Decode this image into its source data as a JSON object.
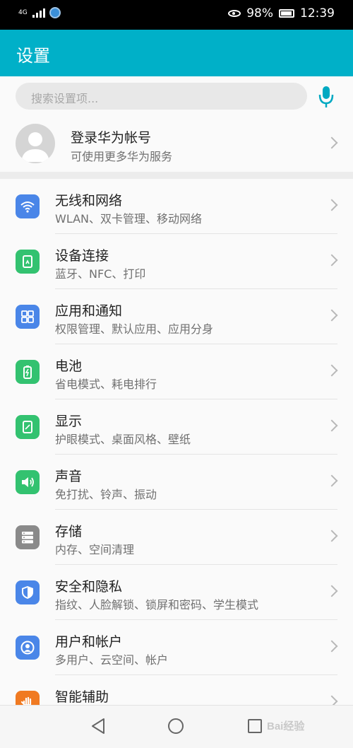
{
  "status_bar": {
    "network": "4G",
    "battery": "98%",
    "time": "12:39"
  },
  "header": {
    "title": "设置"
  },
  "search": {
    "placeholder": "搜索设置项..."
  },
  "account": {
    "title": "登录华为帐号",
    "subtitle": "可使用更多华为服务"
  },
  "settings": [
    {
      "title": "无线和网络",
      "subtitle": "WLAN、双卡管理、移动网络",
      "icon": "wifi-icon",
      "color": "#4a86e8"
    },
    {
      "title": "设备连接",
      "subtitle": "蓝牙、NFC、打印",
      "icon": "device-connection-icon",
      "color": "#33c270"
    },
    {
      "title": "应用和通知",
      "subtitle": "权限管理、默认应用、应用分身",
      "icon": "apps-grid-icon",
      "color": "#4a86e8"
    },
    {
      "title": "电池",
      "subtitle": "省电模式、耗电排行",
      "icon": "battery-icon",
      "color": "#33c270"
    },
    {
      "title": "显示",
      "subtitle": "护眼模式、桌面风格、壁纸",
      "icon": "display-icon",
      "color": "#33c270"
    },
    {
      "title": "声音",
      "subtitle": "免打扰、铃声、振动",
      "icon": "speaker-icon",
      "color": "#33c270"
    },
    {
      "title": "存储",
      "subtitle": "内存、空间清理",
      "icon": "storage-icon",
      "color": "#8a8a8a"
    },
    {
      "title": "安全和隐私",
      "subtitle": "指纹、人脸解锁、锁屏和密码、学生模式",
      "icon": "shield-icon",
      "color": "#4a86e8"
    },
    {
      "title": "用户和帐户",
      "subtitle": "多用户、云空间、帐户",
      "icon": "user-account-icon",
      "color": "#4a86e8"
    },
    {
      "title": "智能辅助",
      "subtitle": "",
      "icon": "hand-icon",
      "color": "#f07a22"
    }
  ],
  "watermark": "Bai经验",
  "accent_color": "#00b0c8"
}
